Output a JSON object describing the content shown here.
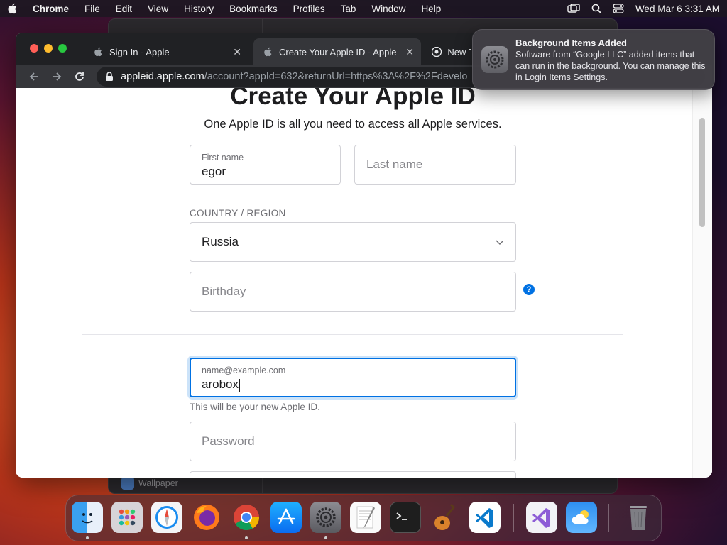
{
  "menubar": {
    "app_name": "Chrome",
    "items": [
      "File",
      "Edit",
      "View",
      "History",
      "Bookmarks",
      "Profiles",
      "Tab",
      "Window",
      "Help"
    ],
    "clock": "Wed Mar 6  3:31 AM"
  },
  "background_window": {
    "sidebar_item": "Wallpaper"
  },
  "browser": {
    "tabs": [
      {
        "label": "Sign In - Apple",
        "icon": "apple-icon",
        "close": "✕"
      },
      {
        "label": "Create Your Apple ID - Apple",
        "icon": "apple-icon",
        "close": "✕",
        "active": true
      },
      {
        "label": "New T",
        "icon": "chrome-icon"
      }
    ],
    "url_host": "appleid.apple.com",
    "url_path": "/account?appId=632&returnUrl=https%3A%2F%2Fdevelo"
  },
  "form": {
    "title": "Create Your Apple ID",
    "subtitle": "One Apple ID is all you need to access all Apple services.",
    "first_name": {
      "label": "First name",
      "value": "egor"
    },
    "last_name": {
      "placeholder": "Last name"
    },
    "country_label": "COUNTRY / REGION",
    "country": {
      "value": "Russia"
    },
    "birthday": {
      "placeholder": "Birthday"
    },
    "help": "?",
    "email": {
      "label": "name@example.com",
      "value": "arobox"
    },
    "email_hint": "This will be your new Apple ID.",
    "password": {
      "placeholder": "Password"
    }
  },
  "notification": {
    "title": "Background Items Added",
    "body": "Software from “Google LLC” added items that can run in the background. You can manage this in Login Items Settings."
  },
  "dock": {
    "apps": [
      "finder-icon",
      "launchpad-icon",
      "safari-icon",
      "firefox-icon",
      "chrome-icon",
      "app-store-icon",
      "system-settings-icon",
      "textedit-icon",
      "terminal-icon",
      "garageband-icon",
      "vscode-icon",
      "visual-studio-icon",
      "weather-icon",
      "trash-icon"
    ]
  },
  "colors": {
    "accent": "#0071e3",
    "tab_strip": "#202124",
    "toolbar": "#35363a"
  }
}
